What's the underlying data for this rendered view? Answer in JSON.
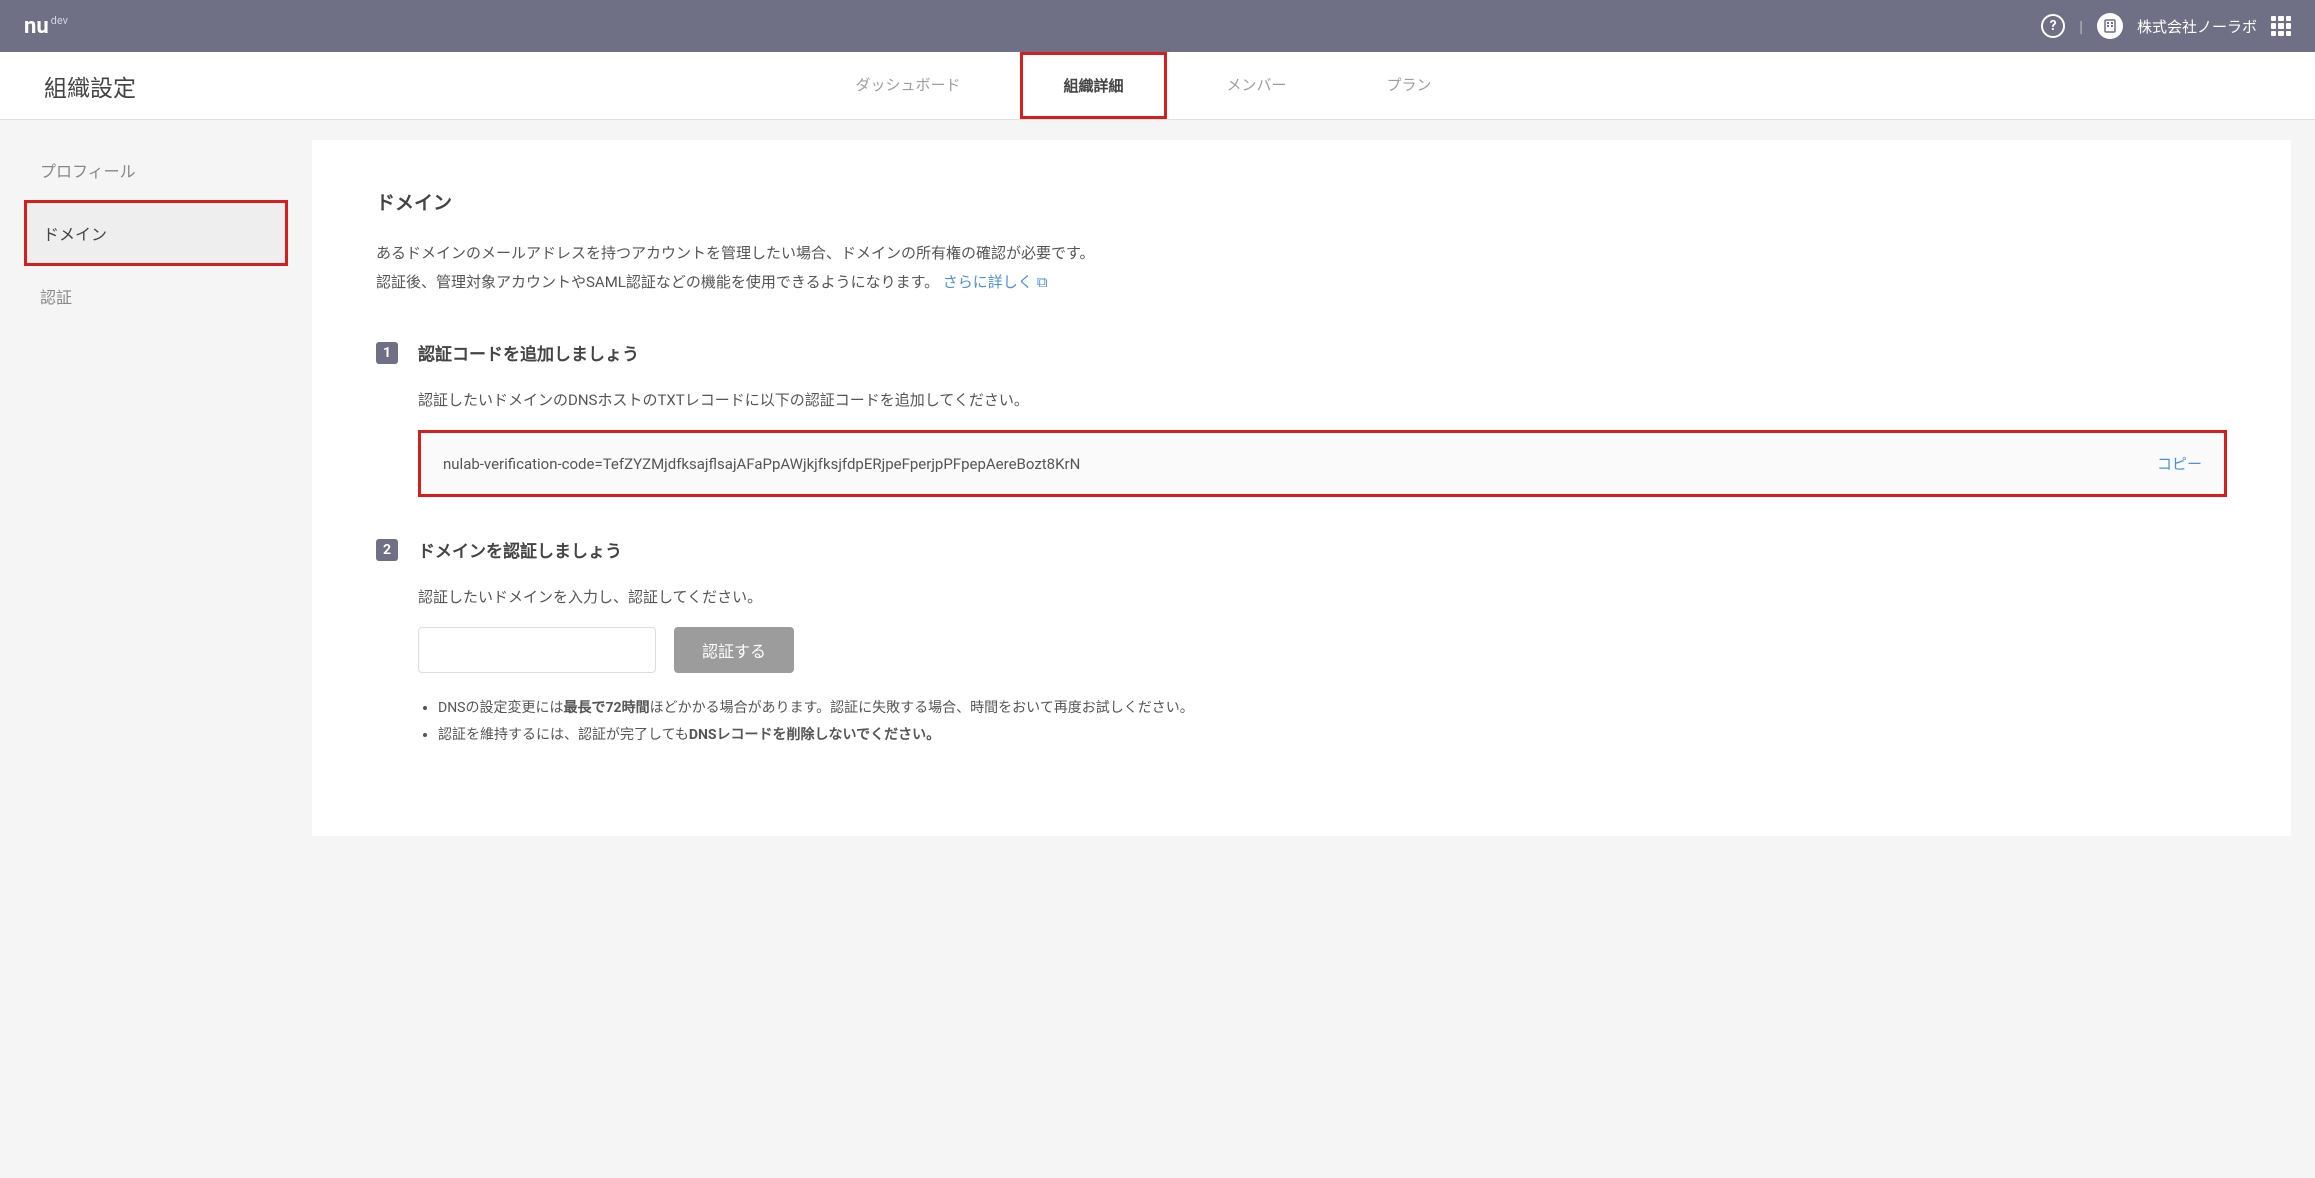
{
  "topbar": {
    "brand": "nu",
    "brand_suffix": "dev",
    "org_name": "株式会社ノーラボ"
  },
  "subhead": {
    "title": "組織設定",
    "tabs": [
      {
        "label": "ダッシュボード",
        "active": false
      },
      {
        "label": "組織詳細",
        "active": true
      },
      {
        "label": "メンバー",
        "active": false
      },
      {
        "label": "プラン",
        "active": false
      }
    ]
  },
  "sidebar": {
    "items": [
      {
        "label": "プロフィール",
        "active": false
      },
      {
        "label": "ドメイン",
        "active": true
      },
      {
        "label": "認証",
        "active": false
      }
    ]
  },
  "main": {
    "heading": "ドメイン",
    "desc_line1": "あるドメインのメールアドレスを持つアカウントを管理したい場合、ドメインの所有権の確認が必要です。",
    "desc_line2_prefix": "認証後、管理対象アカウントやSAML認証などの機能を使用できるようになります。 ",
    "learn_more": "さらに詳しく",
    "step1": {
      "num": "1",
      "title": "認証コードを追加しましょう",
      "instruction": "認証したいドメインのDNSホストのTXTレコードに以下の認証コードを追加してください。",
      "code": "nulab-verification-code=TefZYZMjdfksajflsajAFaPpAWjkjfksjfdpERjpeFperjpPFpepAereBozt8KrN",
      "copy": "コピー"
    },
    "step2": {
      "num": "2",
      "title": "ドメインを認証しましょう",
      "instruction": "認証したいドメインを入力し、認証してください。",
      "button": "認証する",
      "note1_a": "DNSの設定変更には",
      "note1_b": "最長で72時間",
      "note1_c": "ほどかかる場合があります。認証に失敗する場合、時間をおいて再度お試しください。",
      "note2_a": "認証を維持するには、認証が完了しても",
      "note2_b": "DNSレコードを削除しないでください。"
    }
  }
}
